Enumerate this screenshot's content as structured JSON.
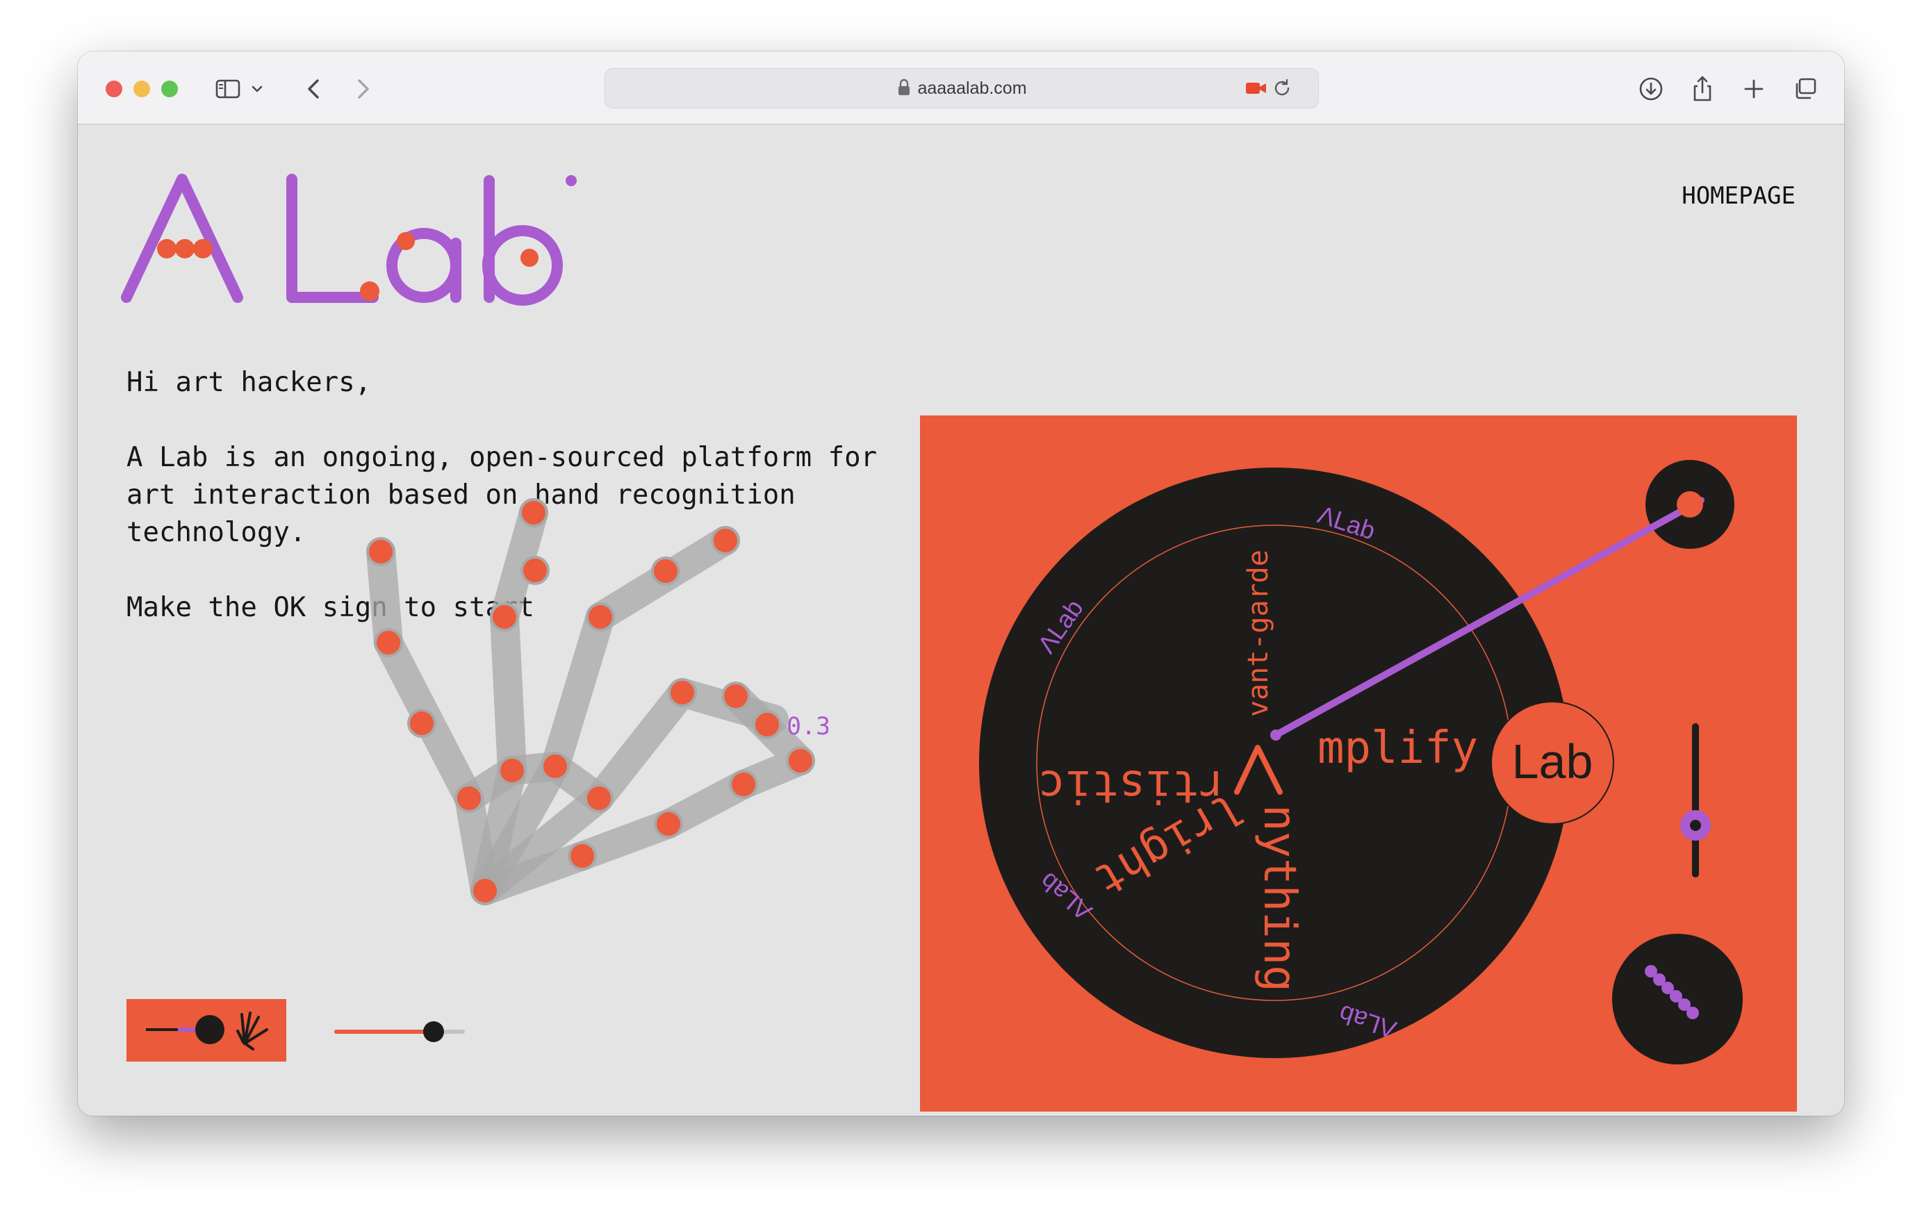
{
  "browser": {
    "url": "aaaaalab.com",
    "icons": [
      "sidebar-icon",
      "chevron-down-icon",
      "back-icon",
      "forward-icon",
      "lock-icon",
      "camera-icon",
      "reload-icon",
      "download-icon",
      "share-icon",
      "new-tab-icon",
      "tabs-overview-icon"
    ]
  },
  "site": {
    "logo_text": "A Lab",
    "nav_homepage": "HOMEPAGE",
    "greeting": "Hi art hackers,",
    "description": "A Lab is an ongoing, open-sourced platform for art interaction based on hand recognition technology.",
    "cta": "Make the OK sign to start",
    "timer": "0.3s"
  },
  "turntable": {
    "ring_labels": [
      "ΛLab",
      "ΛLab",
      "ΛLab",
      "ΛLab"
    ],
    "center_glyph": "Λ",
    "words": [
      "vant-garde",
      "mplify",
      "rtistic",
      "lright",
      "nything"
    ],
    "side_label": "Lab"
  },
  "controls": {
    "hand_toggle_on": true,
    "slider_value": 0.78
  },
  "colors": {
    "accent_orange": "#eb5a3a",
    "accent_purple": "#a95bd0",
    "dark": "#1d1c1a",
    "background": "#e4e4e5"
  }
}
